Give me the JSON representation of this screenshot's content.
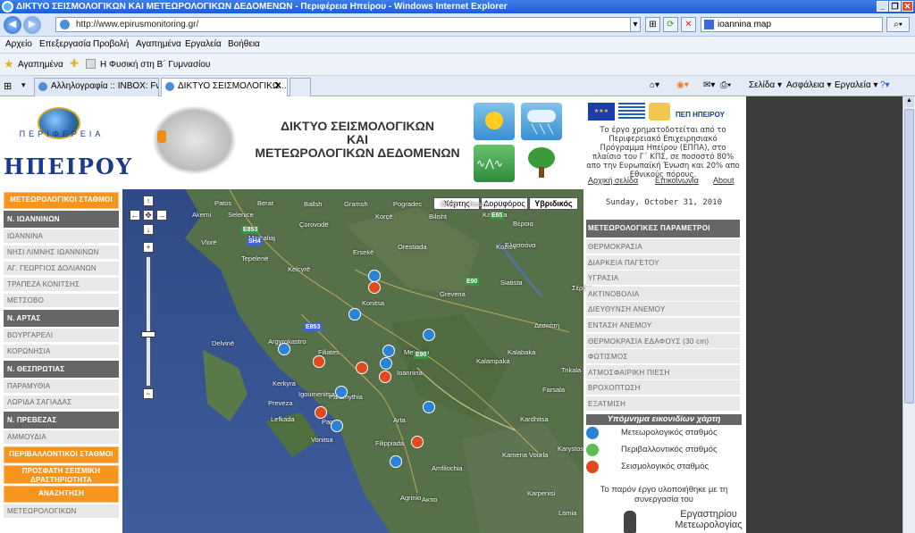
{
  "browser": {
    "window_title": "ΔΙΚΤΥΟ ΣΕΙΣΜΟΛΟΓΙΚΩΝ ΚΑΙ ΜΕΤΕΩΡΟΛΟΓΙΚΩΝ ΔΕΔΟΜΕΝΩΝ - Περιφέρεια Ηπείρου - Windows Internet Explorer",
    "url": "http://www.epirusmonitoring.gr/",
    "search_value": "ioannina map",
    "menu": [
      "Αρχείο",
      "Επεξεργασία",
      "Προβολή",
      "Αγαπημένα",
      "Εργαλεία",
      "Βοήθεια"
    ],
    "favorites_label": "Αγαπημένα",
    "favorite_link": "Η Φυσική στη Β΄ Γυμνασίου",
    "tabs": [
      "Αλληλογραφία :: INBOX: Fw...",
      "ΔΙΚΤΥΟ ΣΕΙΣΜΟΛΟΓΙΚΩ..."
    ],
    "tab_close": "✕",
    "toolbar_right": [
      "Σελίδα ▾",
      "Ασφάλεια ▾",
      "Εργαλεία ▾"
    ],
    "window_buttons": [
      "_",
      "❐",
      "✕"
    ]
  },
  "header": {
    "region_small": "ΠΕΡΙΦΕΡΕΙΑ",
    "region_big": "ΗΠΕΙΡΟΥ",
    "site_title_1": "ΔΙΚΤΥΟ ΣΕΙΣΜΟΛΟΓΙΚΩΝ",
    "site_title_2": "ΚΑΙ",
    "site_title_3": "ΜΕΤΕΩΡΟΛΟΓΙΚΩΝ ΔΕΔΟΜΕΝΩΝ",
    "pep_label": "ΠΕΠ ΗΠΕΙΡΟΥ",
    "funding_text": "Το έργο χρηματοδοτείται από το Περιφερειακό Επιχειρησιακό Πρόγραμμα Ηπείρου (ΕΠΠΑ), στο πλαίσιο του Γ΄ ΚΠΣ, σε ποσοστό 80% απο την Ευρωπαϊκή Ένωση και 20% απο Εθνικούς πόρους.",
    "links": [
      "Αρχική σελίδα",
      "Επικοινωνία",
      "About"
    ]
  },
  "left_menu": [
    {
      "type": "or",
      "label": "ΜΕΤΕΩΡΟΛΟΓΙΚΟΙ ΣΤΑΘΜΟΙ"
    },
    {
      "type": "hd",
      "label": "Ν. ΙΩΑΝΝΙΝΩΝ"
    },
    {
      "type": "it",
      "label": "ΙΩΑΝΝΙΝΑ"
    },
    {
      "type": "it",
      "label": "ΝΗΣΙ ΛΙΜΝΗΣ ΙΩΑΝΝΙΝΩΝ"
    },
    {
      "type": "it",
      "label": "ΑΓ. ΓΕΩΡΓΙΟΣ ΔΟΛΙΑΝΩΝ"
    },
    {
      "type": "it",
      "label": "ΤΡΑΠΕΖΑ ΚΟΝΙΤΣΗΣ"
    },
    {
      "type": "it",
      "label": "ΜΕΤΣΟΒΟ"
    },
    {
      "type": "hd",
      "label": "Ν. ΑΡΤΑΣ"
    },
    {
      "type": "it",
      "label": "ΒΟΥΡΓΑΡΕΛΙ"
    },
    {
      "type": "it",
      "label": "ΚΟΡΩΝΗΣΙΑ"
    },
    {
      "type": "hd",
      "label": "Ν. ΘΕΣΠΡΩΤΙΑΣ"
    },
    {
      "type": "it",
      "label": "ΠΑΡΑΜΥΘΙΑ"
    },
    {
      "type": "it",
      "label": "ΛΩΡΙΔΑ ΣΑΓΙΑΔΑΣ"
    },
    {
      "type": "hd",
      "label": "Ν. ΠΡΕΒΕΖΑΣ"
    },
    {
      "type": "it",
      "label": "ΑΜΜΟΥΔΙΑ"
    },
    {
      "type": "or",
      "label": "ΠΕΡΙΒΑΛΛΟΝΤΙΚΟΙ ΣΤΑΘΜΟΙ"
    },
    {
      "type": "or2",
      "label": "ΠΡΟΣΦΑΤΗ ΣΕΙΣΜΙΚΗ ΔΡΑΣΤΗΡΙΟΤΗΤΑ"
    },
    {
      "type": "or",
      "label": "ΑΝΑΖΗΤΗΣΗ"
    },
    {
      "type": "it",
      "label": "ΜΕΤΕΩΡΟΛΟΓΙΚΩΝ"
    }
  ],
  "map": {
    "types": [
      "Χάρτης",
      "Δορυφόρος",
      "Υβριδικός"
    ],
    "labels": [
      "Patos",
      "Berat",
      "Ballsh",
      "Gramsh",
      "Pogradec",
      "Ohrid",
      "Resen",
      "Akerni",
      "Selenice",
      "Çorovodë",
      "Korçë",
      "Bilisht",
      "Kastoria",
      "Vlorë",
      "Memaliaj",
      "Kelcyrë",
      "Ersekë",
      "Orestiada",
      "Kozani",
      "Tepelenë",
      "Grevena",
      "Siatista",
      "Argyrokastro",
      "Delvinë",
      "Konitsa",
      "Kalabaka",
      "Trikala",
      "Kerkyra",
      "Filiates",
      "Paramythia",
      "Ioannina",
      "Metsovo",
      "Kalampaka",
      "Preveza",
      "Igoumenitsa",
      "Parga",
      "Arta",
      "Filippiada",
      "Amfilochia",
      "Lefkada",
      "Agrinio",
      "Karpenisi",
      "Lamia",
      "Kardhitsa",
      "Farsala",
      "Vonitsa",
      "Karystos",
      "Kamena Vourla",
      "Ελασσόνα",
      "Βέροια",
      "Σέρβια",
      "Δεσκάτη",
      "Ακτιο"
    ],
    "highways": [
      "E853",
      "SH4",
      "E65",
      "E90",
      "E90",
      "E853"
    ]
  },
  "right_panel": {
    "date": "Sunday, October 31, 2010",
    "params_header": "ΜΕΤΕΩΡΟΛΟΓΙΚΕΣ ΠΑΡΑΜΕΤΡΟΙ",
    "params": [
      "ΘΕΡΜΟΚΡΑΣΙΑ",
      "ΔΙΑΡΚΕΙΑ ΠΑΓΕΤΟΥ",
      "ΥΓΡΑΣΙΑ",
      "ΑΚΤΙΝΟΒΟΛΙΑ",
      "ΔΙΕΥΘΥΝΣΗ ΑΝΕΜΟΥ",
      "ΕΝΤΑΣΗ ΑΝΕΜΟΥ",
      "ΘΕΡΜΟΚΡΑΣΙΑ ΕΔΑΦΟΥΣ (30 cm)",
      "ΦΩΤΙΣΜΟΣ",
      "ΑΤΜΟΣΦΑΙΡΙΚΗ ΠΙΕΣΗ",
      "ΒΡΟΧΟΠΤΩΣΗ",
      "ΕΞΑΤΜΙΣΗ"
    ],
    "legend_title": "Υπόμνημα εικονιδίων χάρτη",
    "legend": [
      {
        "label": "Μετεωρολογικός σταθμός",
        "color": "#2a83d6"
      },
      {
        "label": "Περιβαλλοντικός σταθμός",
        "color": "#5cbf55"
      },
      {
        "label": "Σεισμολογικός σταθμός",
        "color": "#e14a1c"
      }
    ],
    "collab_text": "Το παρόν έργο υλοποιήθηκε με τη συνεργασία του",
    "lab_text": "Εργαστηρίου Μετεωρολογίας"
  }
}
